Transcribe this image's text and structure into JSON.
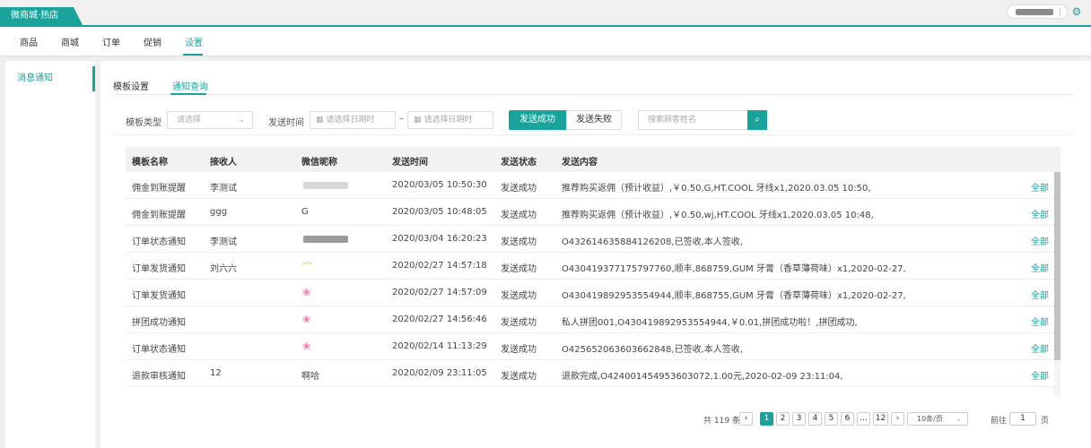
{
  "shop_tab": "微商城·热店",
  "nav": [
    "商品",
    "商城",
    "订单",
    "促销",
    "设置"
  ],
  "side": {
    "item": "消息通知"
  },
  "subtabs": [
    "模板设置",
    "通知查询"
  ],
  "filters": {
    "template_type_label": "模板类型",
    "template_type_placeholder": "请选择",
    "send_time_label": "发送时间",
    "date_start_placeholder": "请选择日期时",
    "date_dash": "–",
    "date_end_placeholder": "请选择日期时",
    "success_btn": "发送成功",
    "fail_btn": "发送失败",
    "search_placeholder": "搜索顾客姓名"
  },
  "table": {
    "headers": [
      "模板名称",
      "接收人",
      "微信昵称",
      "发送时间",
      "发送状态",
      "发送内容"
    ],
    "rows": [
      {
        "name": "佣金到账提醒",
        "receiver": "李测试",
        "nickname": "",
        "time": "2020/03/05 10:50:30",
        "status": "发送成功",
        "content": "推荐购买返佣（预计收益）,￥0.50,G,HT.COOL 牙线x1,2020.03.05 10:50,",
        "action": "全部"
      },
      {
        "name": "佣金到账提醒",
        "receiver": "ggg",
        "nickname": "G",
        "time": "2020/03/05 10:48:05",
        "status": "发送成功",
        "content": "推荐购买返佣（预计收益）,￥0.50,wj,HT.COOL 牙线x1,2020.03.05 10:48,",
        "action": "全部"
      },
      {
        "name": "订单状态通知",
        "receiver": "李测试",
        "nickname": "",
        "time": "2020/03/04 16:20:23",
        "status": "发送成功",
        "content": "O432614635884126208,已签收,本人签收,",
        "action": "全部"
      },
      {
        "name": "订单发货通知",
        "receiver": "刘六六",
        "nickname": "",
        "time": "2020/02/27 14:57:18",
        "status": "发送成功",
        "content": "O430419377175797760,顺丰,868759,GUM 牙膏（香草薄荷味）x1,2020-02-27,",
        "action": "全部"
      },
      {
        "name": "订单发货通知",
        "receiver": "",
        "nickname": "",
        "time": "2020/02/27 14:57:09",
        "status": "发送成功",
        "content": "O430419892953554944,顺丰,868755,GUM 牙膏（香草薄荷味）x1,2020-02-27,",
        "action": "全部"
      },
      {
        "name": "拼团成功通知",
        "receiver": "",
        "nickname": "",
        "time": "2020/02/27 14:56:46",
        "status": "发送成功",
        "content": "私人拼团001,O430419892953554944,￥0.01,拼团成功啦！,拼团成功,",
        "action": "全部"
      },
      {
        "name": "订单状态通知",
        "receiver": "",
        "nickname": "",
        "time": "2020/02/14 11:13:29",
        "status": "发送成功",
        "content": "O425652063603662848,已签收,本人签收,",
        "action": "全部"
      },
      {
        "name": "退款审核通知",
        "receiver": "12",
        "nickname": "啊哈",
        "time": "2020/02/09 23:11:05",
        "status": "发送成功",
        "content": "退款完成,O424001454953603072,1.00元,2020-02-09 23:11:04,",
        "action": "全部"
      }
    ]
  },
  "pagination": {
    "total": "共 119 条",
    "pages": [
      "1",
      "2",
      "3",
      "4",
      "5",
      "6",
      "...",
      "12"
    ],
    "current": "1",
    "page_size": "10条/页",
    "goto_label": "前往",
    "goto_value": "1",
    "page_suffix": "页"
  },
  "icons": {
    "settings": "gear-icon",
    "calendar": "calendar-icon",
    "search": "search-icon",
    "prev": "chevron-left-icon",
    "next": "chevron-right-icon"
  },
  "colors": {
    "accent": "#1aa39a"
  }
}
